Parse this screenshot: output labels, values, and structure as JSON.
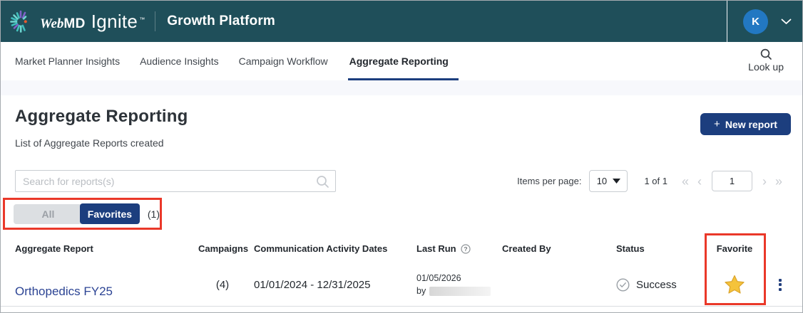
{
  "header": {
    "brand_web": "Web",
    "brand_md": "MD",
    "brand_ignite": "Ignite",
    "brand_tm": "™",
    "platform": "Growth Platform",
    "avatar_initial": "K"
  },
  "nav": {
    "tabs": [
      {
        "label": "Market Planner Insights",
        "active": false
      },
      {
        "label": "Audience Insights",
        "active": false
      },
      {
        "label": "Campaign Workflow",
        "active": false
      },
      {
        "label": "Aggregate Reporting",
        "active": true
      }
    ],
    "lookup_label": "Look up"
  },
  "page": {
    "title": "Aggregate Reporting",
    "subtitle": "List of Aggregate Reports created",
    "new_report": {
      "icon": "+",
      "label": "New report"
    }
  },
  "toolbar": {
    "search_placeholder": "Search for reports(s)",
    "items_per_page_label": "Items per page:",
    "items_per_page_value": "10",
    "page_info": "1 of 1",
    "page_number": "1",
    "pagination": {
      "first": "«",
      "prev": "‹",
      "next": "›",
      "last": "»"
    }
  },
  "filters": {
    "all_label": "All",
    "favorites_label": "Favorites",
    "favorites_count": "(1)"
  },
  "table": {
    "headers": [
      "Aggregate Report",
      "Campaigns",
      "Communication Activity Dates",
      "Last Run",
      "Created By",
      "Status",
      "Favorite"
    ],
    "rows": [
      {
        "name": "Orthopedics FY25",
        "campaigns": "(4)",
        "dates": "01/01/2024 - 12/31/2025",
        "last_run_date": "01/05/2026",
        "last_run_by_prefix": "by",
        "status": "Success"
      }
    ]
  },
  "colors": {
    "header_bg": "#1F4F5A",
    "navy_accent": "#1C3E7E",
    "avatar_blue": "#2278C2",
    "annotation_red": "#EA3829",
    "star_gold": "#F5C33B",
    "link_blue": "#2C4494",
    "band_bg": "#F7F8FC"
  }
}
